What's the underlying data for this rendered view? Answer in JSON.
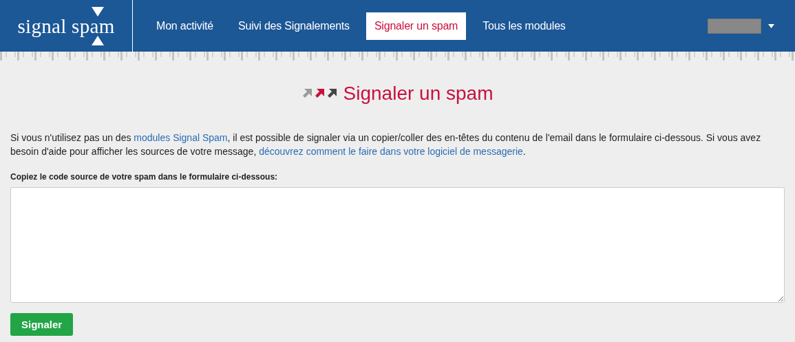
{
  "logo": {
    "text": "signal spam"
  },
  "nav": [
    {
      "label": "Mon activité",
      "selected": false
    },
    {
      "label": "Suivi des Signalements",
      "selected": false
    },
    {
      "label": "Signaler un spam",
      "selected": true
    },
    {
      "label": "Tous les modules",
      "selected": false
    }
  ],
  "page": {
    "title": "Signaler un spam",
    "intro": [
      {
        "kind": "text",
        "text": "Si vous n'utilisez pas un des "
      },
      {
        "kind": "link",
        "text": "modules Signal Spam"
      },
      {
        "kind": "text",
        "text": ", il est possible de signaler via un copier/coller des en-têtes du contenu de l'email dans le formulaire ci-dessous. Si vous avez besoin d'aide pour afficher les sources de votre message, "
      },
      {
        "kind": "link",
        "text": "découvrez comment le faire dans votre logiciel de messagerie"
      },
      {
        "kind": "text",
        "text": "."
      }
    ],
    "field_label": "Copiez le code source de votre spam dans le formulaire ci-dessous:",
    "submit": "Signaler"
  }
}
